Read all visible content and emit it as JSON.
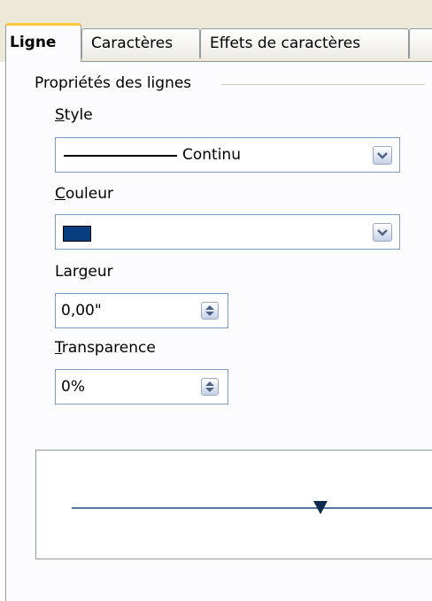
{
  "tabs": [
    {
      "label": "Ligne",
      "active": true
    },
    {
      "label": "Caractères",
      "active": false
    },
    {
      "label": "Effets de caractères",
      "active": false
    }
  ],
  "group": {
    "title": "Propriétés des lignes"
  },
  "style": {
    "label": "Style",
    "value": "Continu"
  },
  "color": {
    "label": "Couleur",
    "swatch": "#0a3c80"
  },
  "width": {
    "label": "Largeur",
    "value": "0,00\""
  },
  "transparency": {
    "label": "Transparence",
    "value": "0%"
  },
  "colors": {
    "preview_line": "#1a4b7e",
    "active_tab_accent": "#ffc83c"
  }
}
